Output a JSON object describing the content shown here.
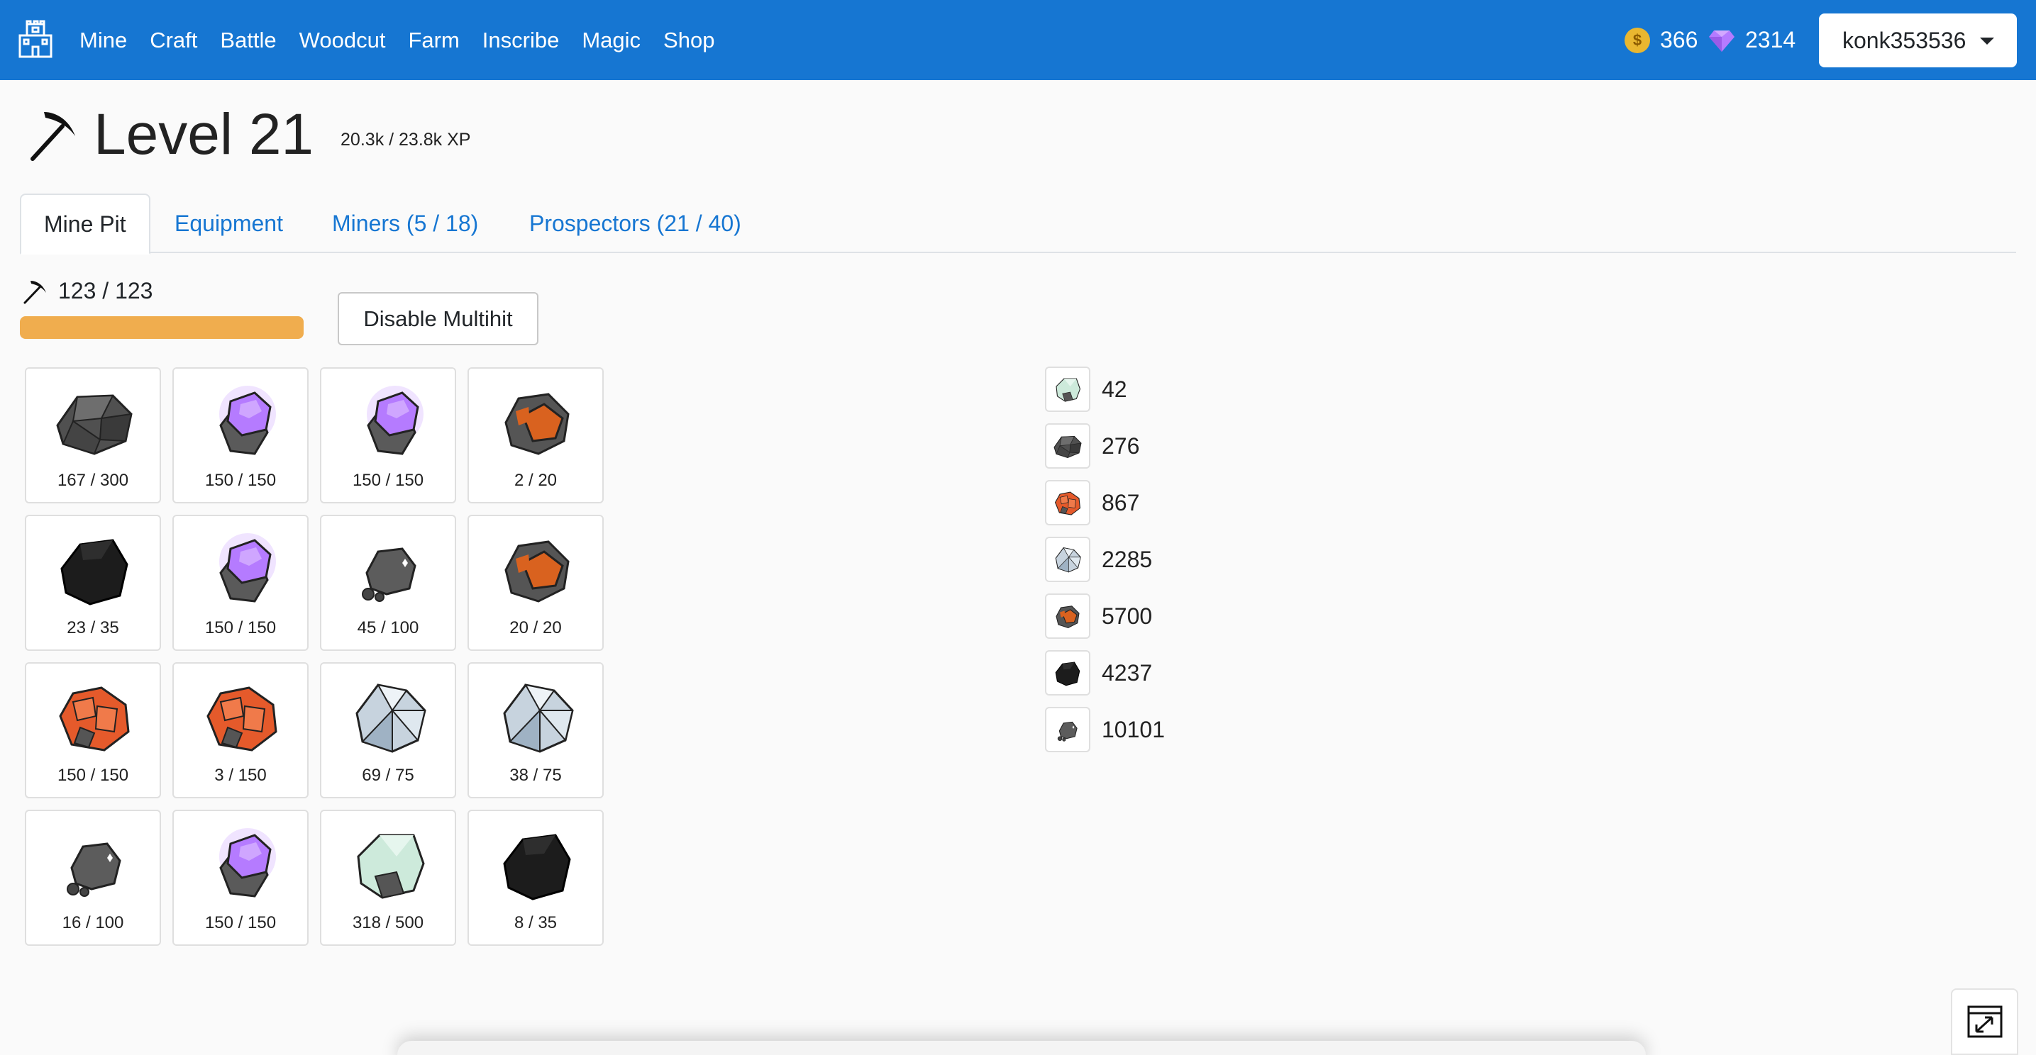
{
  "nav": {
    "links": [
      "Mine",
      "Craft",
      "Battle",
      "Woodcut",
      "Farm",
      "Inscribe",
      "Magic",
      "Shop"
    ],
    "gold": "366",
    "gems": "2314",
    "username": "konk353536",
    "colors": {
      "bar": "#1676d2",
      "gold": "#e9b730",
      "gem": "#b57bff"
    }
  },
  "header": {
    "level": "Level 21",
    "xp": "20.3k / 23.8k XP"
  },
  "tabs": [
    "Mine Pit",
    "Equipment",
    "Miners (5 / 18)",
    "Prospectors (21 / 40)"
  ],
  "mine": {
    "energy": "123 / 123",
    "energy_fraction": 1.0,
    "multihit_label": "Disable Multihit",
    "ores": [
      {
        "type": "coal",
        "hp": "167 / 300"
      },
      {
        "type": "amethyst",
        "hp": "150 / 150"
      },
      {
        "type": "amethyst",
        "hp": "150 / 150"
      },
      {
        "type": "copper",
        "hp": "2 / 20"
      },
      {
        "type": "obsidian",
        "hp": "23 / 35"
      },
      {
        "type": "amethyst",
        "hp": "150 / 150"
      },
      {
        "type": "stone",
        "hp": "45 / 100"
      },
      {
        "type": "copper",
        "hp": "20 / 20"
      },
      {
        "type": "ruby",
        "hp": "150 / 150"
      },
      {
        "type": "ruby",
        "hp": "3 / 150"
      },
      {
        "type": "silver",
        "hp": "69 / 75"
      },
      {
        "type": "silver",
        "hp": "38 / 75"
      },
      {
        "type": "stone",
        "hp": "16 / 100"
      },
      {
        "type": "amethyst",
        "hp": "150 / 150"
      },
      {
        "type": "jade",
        "hp": "318 / 500"
      },
      {
        "type": "obsidian",
        "hp": "8 / 35"
      }
    ]
  },
  "inventory": [
    {
      "type": "jade",
      "count": "42"
    },
    {
      "type": "coal",
      "count": "276"
    },
    {
      "type": "ruby",
      "count": "867"
    },
    {
      "type": "silver",
      "count": "2285"
    },
    {
      "type": "copper",
      "count": "5700"
    },
    {
      "type": "obsidian",
      "count": "4237"
    },
    {
      "type": "stone",
      "count": "10101"
    }
  ],
  "ore_colors": {
    "coal": "#4a4a4a",
    "amethyst": "#b57bff",
    "copper": "#d9621f",
    "obsidian": "#1c1c1c",
    "stone": "#5c5c5c",
    "ruby": "#e55a2b",
    "silver": "#c7d3de",
    "jade": "#cdeadb"
  }
}
